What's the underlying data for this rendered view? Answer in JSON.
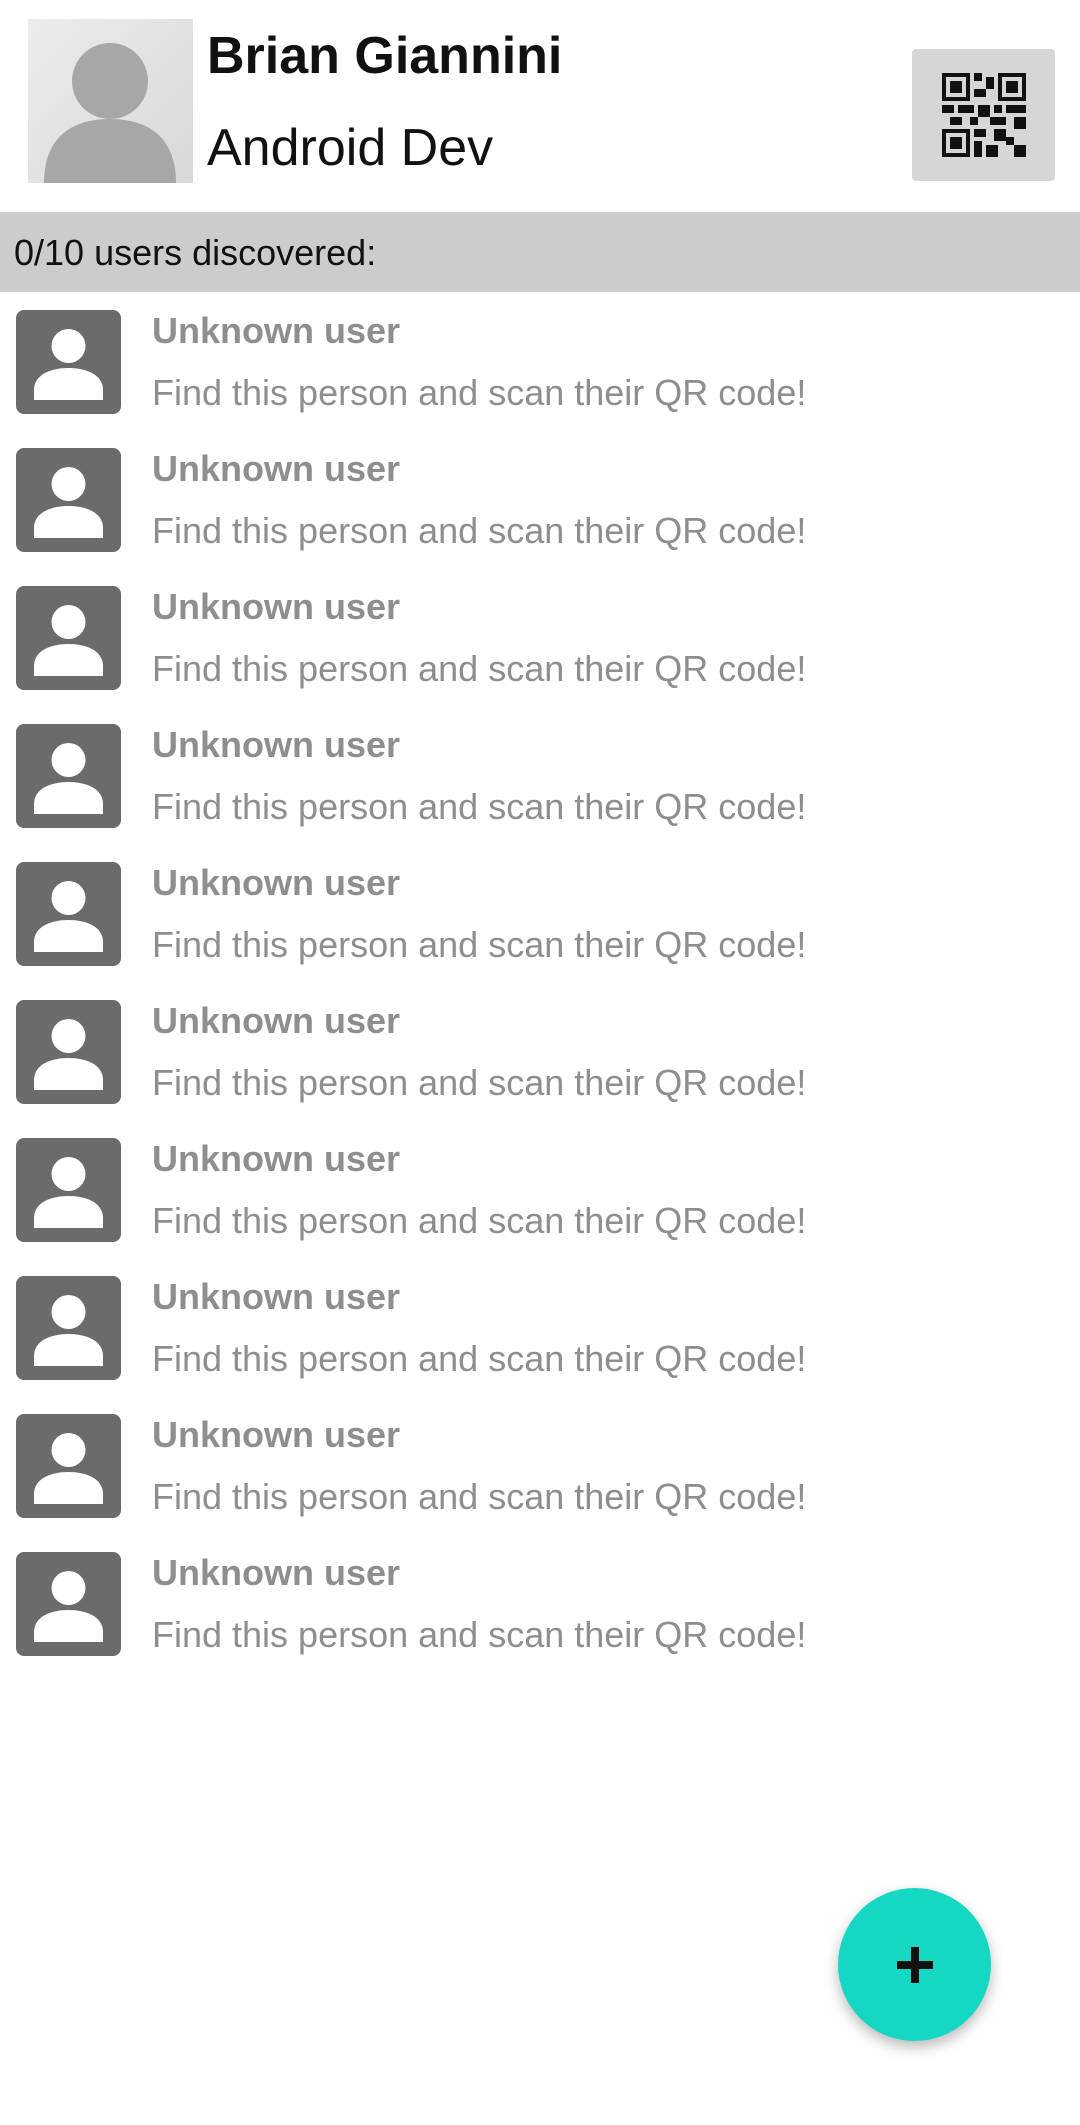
{
  "profile": {
    "name": "Brian Giannini",
    "role": "Android Dev",
    "avatar_icon": "person-silhouette-icon",
    "qr_icon": "qr-code-icon"
  },
  "discovery": {
    "status_text": "0/10 users discovered:",
    "discovered": 0,
    "total": 10
  },
  "users": [
    {
      "name": "Unknown user",
      "hint": "Find this person and scan their QR code!",
      "icon": "person-icon"
    },
    {
      "name": "Unknown user",
      "hint": "Find this person and scan their QR code!",
      "icon": "person-icon"
    },
    {
      "name": "Unknown user",
      "hint": "Find this person and scan their QR code!",
      "icon": "person-icon"
    },
    {
      "name": "Unknown user",
      "hint": "Find this person and scan their QR code!",
      "icon": "person-icon"
    },
    {
      "name": "Unknown user",
      "hint": "Find this person and scan their QR code!",
      "icon": "person-icon"
    },
    {
      "name": "Unknown user",
      "hint": "Find this person and scan their QR code!",
      "icon": "person-icon"
    },
    {
      "name": "Unknown user",
      "hint": "Find this person and scan their QR code!",
      "icon": "person-icon"
    },
    {
      "name": "Unknown user",
      "hint": "Find this person and scan their QR code!",
      "icon": "person-icon"
    },
    {
      "name": "Unknown user",
      "hint": "Find this person and scan their QR code!",
      "icon": "person-icon"
    },
    {
      "name": "Unknown user",
      "hint": "Find this person and scan their QR code!",
      "icon": "person-icon"
    }
  ],
  "fab": {
    "icon": "plus-icon"
  },
  "colors": {
    "accent": "#14d8c3",
    "header_bar": "#cccccc",
    "muted_text": "#8e8e8e",
    "avatar_tile": "#6b6b6b"
  }
}
